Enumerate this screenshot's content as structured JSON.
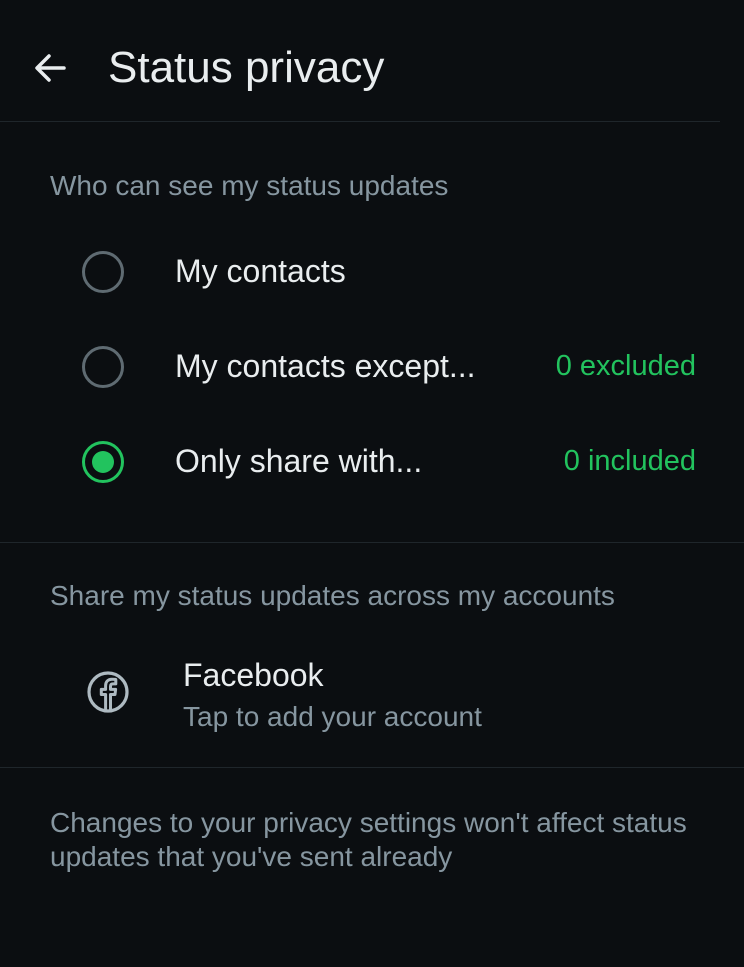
{
  "header": {
    "title": "Status privacy",
    "back_icon": "back-arrow-icon"
  },
  "audience": {
    "header": "Who can see my status updates",
    "options": [
      {
        "label": "My contacts",
        "count": "",
        "selected": false
      },
      {
        "label": "My contacts except...",
        "count": "0 excluded",
        "selected": false
      },
      {
        "label": "Only share with...",
        "count": "0 included",
        "selected": true
      }
    ]
  },
  "accounts": {
    "header": "Share my status updates across my accounts",
    "facebook": {
      "title": "Facebook",
      "subtitle": "Tap to add your account",
      "icon": "facebook-icon"
    }
  },
  "footer": {
    "note": "Changes to your privacy settings won't affect status updates that you've sent already"
  },
  "colors": {
    "background": "#0b0e11",
    "accent": "#22c35e",
    "primary_text": "#e9edef",
    "secondary_text": "#8696a0",
    "divider": "#1f262b"
  }
}
